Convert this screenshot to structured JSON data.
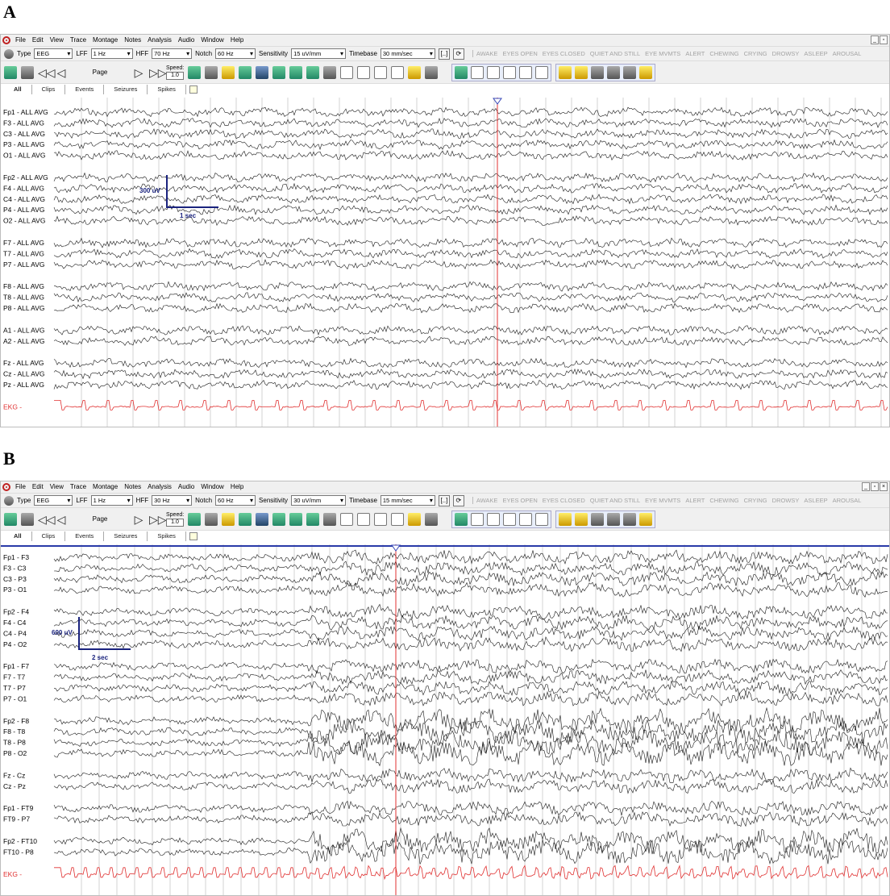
{
  "panels": [
    {
      "label": "A",
      "menu": [
        "File",
        "Edit",
        "View",
        "Trace",
        "Montage",
        "Notes",
        "Analysis",
        "Audio",
        "Window",
        "Help"
      ],
      "settings": {
        "type": "EEG",
        "lff": "1 Hz",
        "hff": "70 Hz",
        "notch": "60 Hz",
        "sensitivity": "15 uV/mm",
        "timebase": "30 mm/sec"
      },
      "labels": {
        "type": "Type",
        "lff": "LFF",
        "hff": "HFF",
        "notch": "Notch",
        "sensitivity": "Sensitivity",
        "timebase": "Timebase"
      },
      "states": [
        "AWAKE",
        "EYES OPEN",
        "EYES CLOSED",
        "QUIET AND STILL",
        "EYE MVMTS",
        "ALERT",
        "CHEWING",
        "CRYING",
        "DROWSY",
        "ASLEEP",
        "AROUSAL"
      ],
      "toolbar": {
        "page": "Page",
        "speed_label": "Speed:",
        "speed_value": "1.0"
      },
      "tabs": [
        "All",
        "Clips",
        "Events",
        "Seizures",
        "Spikes"
      ],
      "scale": {
        "amplitude": "300 uV",
        "time": "1 sec"
      },
      "channels": [
        "Fp1 - ALL AVG",
        "F3 - ALL AVG",
        "C3 - ALL AVG",
        "P3 - ALL AVG",
        "O1 - ALL AVG",
        "Fp2 - ALL AVG",
        "F4 - ALL AVG",
        "C4 - ALL AVG",
        "P4 - ALL AVG",
        "O2 - ALL AVG",
        "F7 - ALL AVG",
        "T7 - ALL AVG",
        "P7 - ALL AVG",
        "F8 - ALL AVG",
        "T8 - ALL AVG",
        "P8 - ALL AVG",
        "A1 - ALL AVG",
        "A2 - ALL AVG",
        "Fz - ALL AVG",
        "Cz - ALL AVG",
        "Pz - ALL AVG",
        "EKG -"
      ],
      "colors": {
        "ekg": "#e03030",
        "cursor": "#e03030",
        "scale": "#1a237e"
      }
    },
    {
      "label": "B",
      "menu": [
        "File",
        "Edit",
        "View",
        "Trace",
        "Montage",
        "Notes",
        "Analysis",
        "Audio",
        "Window",
        "Help"
      ],
      "settings": {
        "type": "EEG",
        "lff": "1 Hz",
        "hff": "30 Hz",
        "notch": "60 Hz",
        "sensitivity": "30 uV/mm",
        "timebase": "15 mm/sec"
      },
      "labels": {
        "type": "Type",
        "lff": "LFF",
        "hff": "HFF",
        "notch": "Notch",
        "sensitivity": "Sensitivity",
        "timebase": "Timebase"
      },
      "states": [
        "AWAKE",
        "EYES OPEN",
        "EYES CLOSED",
        "QUIET AND STILL",
        "EYE MVMTS",
        "ALERT",
        "CHEWING",
        "CRYING",
        "DROWSY",
        "ASLEEP",
        "AROUSAL"
      ],
      "toolbar": {
        "page": "Page",
        "speed_label": "Speed:",
        "speed_value": "1.0"
      },
      "tabs": [
        "All",
        "Clips",
        "Events",
        "Seizures",
        "Spikes"
      ],
      "scale": {
        "amplitude": "600 uV",
        "time": "2 sec"
      },
      "channels": [
        "Fp1 - F3",
        "F3 - C3",
        "C3 - P3",
        "P3 - O1",
        "Fp2 - F4",
        "F4 - C4",
        "C4 - P4",
        "P4 - O2",
        "Fp1 - F7",
        "F7 - T7",
        "T7 - P7",
        "P7 - O1",
        "Fp2 - F8",
        "F8 - T8",
        "T8 - P8",
        "P8 - O2",
        "Fz - Cz",
        "Cz - Pz",
        "Fp1 - FT9",
        "FT9 - P7",
        "Fp2 - FT10",
        "FT10 - P8",
        "EKG -"
      ],
      "colors": {
        "ekg": "#e03030",
        "cursor": "#e03030",
        "scale": "#1a237e"
      }
    }
  ]
}
